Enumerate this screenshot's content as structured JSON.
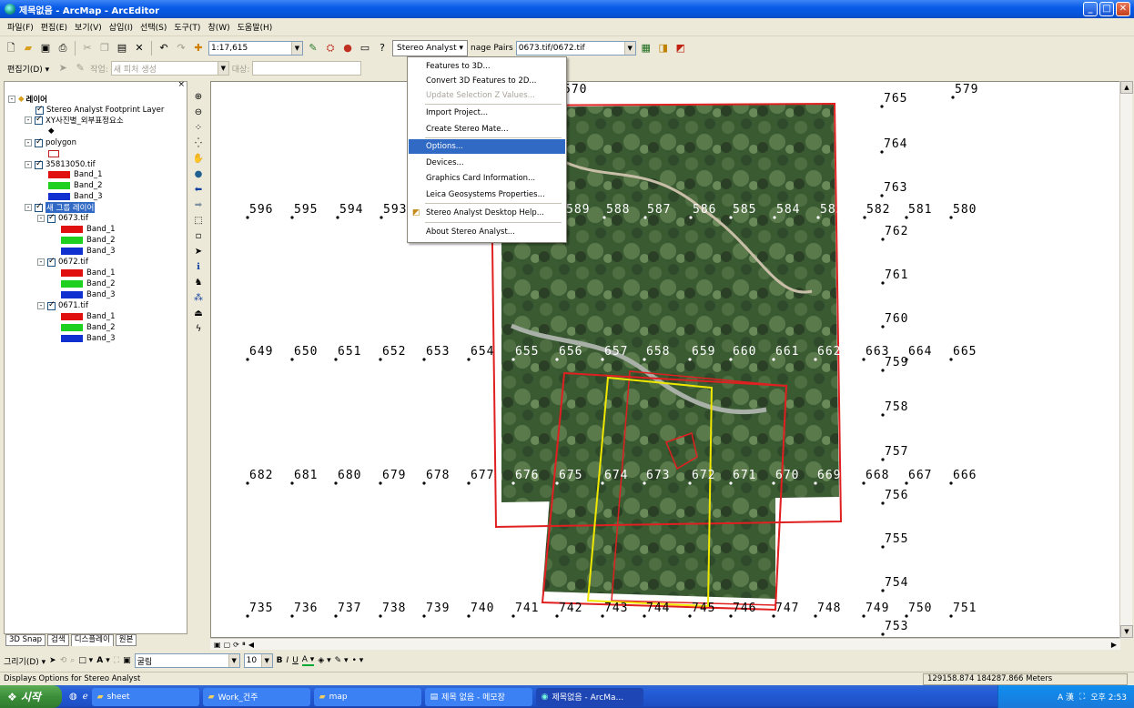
{
  "window": {
    "title": "제목없음 - ArcMap - ArcEditor",
    "min": "_",
    "max": "□",
    "close": "✕"
  },
  "menubar": [
    "파일(F)",
    "편집(E)",
    "보기(V)",
    "삽입(I)",
    "선택(S)",
    "도구(T)",
    "창(W)",
    "도움말(H)"
  ],
  "toolbar1": {
    "scale": "1:17,615",
    "stereo_menu": "Stereo Analyst ▾",
    "image_pairs_label": "nage Pairs",
    "image_pairs_value": "0673.tif/0672.tif"
  },
  "toolbar2": {
    "editor": "편집기(D) ▾",
    "task_label": "작업:",
    "task_value": "새 피처 생성",
    "target_label": "대상:"
  },
  "stereo_menu": {
    "items": [
      {
        "label": "Features to 3D...",
        "state": "normal"
      },
      {
        "label": "Convert 3D Features to 2D...",
        "state": "normal"
      },
      {
        "label": "Update Selection Z Values...",
        "state": "disabled"
      },
      {
        "label": "Import Project...",
        "state": "normal"
      },
      {
        "label": "Create Stereo Mate...",
        "state": "normal"
      },
      {
        "label": "Options...",
        "state": "highlighted"
      },
      {
        "label": "Devices...",
        "state": "normal"
      },
      {
        "label": "Graphics Card Information...",
        "state": "normal"
      },
      {
        "label": "Leica Geosystems Properties...",
        "state": "normal"
      },
      {
        "label": "Stereo Analyst Desktop Help...",
        "state": "normal"
      },
      {
        "label": "About Stereo Analyst...",
        "state": "normal"
      }
    ]
  },
  "toc": {
    "close": "×",
    "rows": [
      {
        "label": "레이어",
        "level": 0,
        "bold": true
      },
      {
        "label": "Stereo Analyst Footprint Layer",
        "level": 1
      },
      {
        "label": "XY사진별_외부표정요소",
        "level": 1
      },
      {
        "label": "polygon",
        "level": 1
      },
      {
        "label": "35813050.tif",
        "level": 1
      },
      {
        "label": "Band_1",
        "level": 2
      },
      {
        "label": "Band_2",
        "level": 2
      },
      {
        "label": "Band_3",
        "level": 2
      },
      {
        "label": "새 그룹 레이어",
        "level": 1,
        "selected": true
      },
      {
        "label": "0673.tif",
        "level": 2
      },
      {
        "label": "Band_1",
        "level": 3
      },
      {
        "label": "Band_2",
        "level": 3
      },
      {
        "label": "Band_3",
        "level": 3
      },
      {
        "label": "0672.tif",
        "level": 2
      },
      {
        "label": "Band_1",
        "level": 3
      },
      {
        "label": "Band_2",
        "level": 3
      },
      {
        "label": "Band_3",
        "level": 3
      },
      {
        "label": "0671.tif",
        "level": 2
      },
      {
        "label": "Band_1",
        "level": 3
      },
      {
        "label": "Band_2",
        "level": 3
      },
      {
        "label": "Band_3",
        "level": 3
      }
    ],
    "tabs": [
      "3D Snap",
      "검색",
      "디스플레이",
      "원본"
    ]
  },
  "map": {
    "points": {
      "row_596": [
        "596",
        "595",
        "594",
        "593",
        "589",
        "588",
        "587",
        "586",
        "585",
        "584",
        "583",
        "582",
        "581",
        "580"
      ],
      "row_649": [
        "649",
        "650",
        "651",
        "652",
        "653",
        "654",
        "655",
        "656",
        "657",
        "658",
        "659",
        "660",
        "661",
        "662",
        "663",
        "664",
        "665"
      ],
      "row_682": [
        "682",
        "681",
        "680",
        "679",
        "678",
        "677",
        "676",
        "675",
        "674",
        "673",
        "672",
        "671",
        "670",
        "669",
        "668",
        "667",
        "666"
      ],
      "row_735": [
        "735",
        "736",
        "737",
        "738",
        "739",
        "740",
        "741",
        "742",
        "743",
        "744",
        "745",
        "746",
        "747",
        "748",
        "749",
        "750",
        "751"
      ],
      "column": [
        "765",
        "579",
        "570",
        "764",
        "763",
        "762",
        "761",
        "760",
        "759",
        "758",
        "757",
        "756",
        "755",
        "754",
        "753"
      ]
    },
    "colors": {
      "footprint": "#e02020",
      "stereo_pair": "#f0e800"
    }
  },
  "drawbar": {
    "draw": "그리기(D) ▾",
    "font": "굴림",
    "size": "10",
    "bold": "B",
    "italic": "I",
    "underline": "U"
  },
  "status": {
    "message": "Displays Options for Stereo Analyst",
    "coords": "129158.874  184287.866 Meters"
  },
  "taskbar": {
    "start": "시작",
    "tasks": [
      "sheet",
      "Work_건주",
      "map",
      "제목 없음 - 메모장",
      "제목없음 - ArcMa..."
    ],
    "clock": "오후 2:53",
    "ime": "A 漢"
  }
}
